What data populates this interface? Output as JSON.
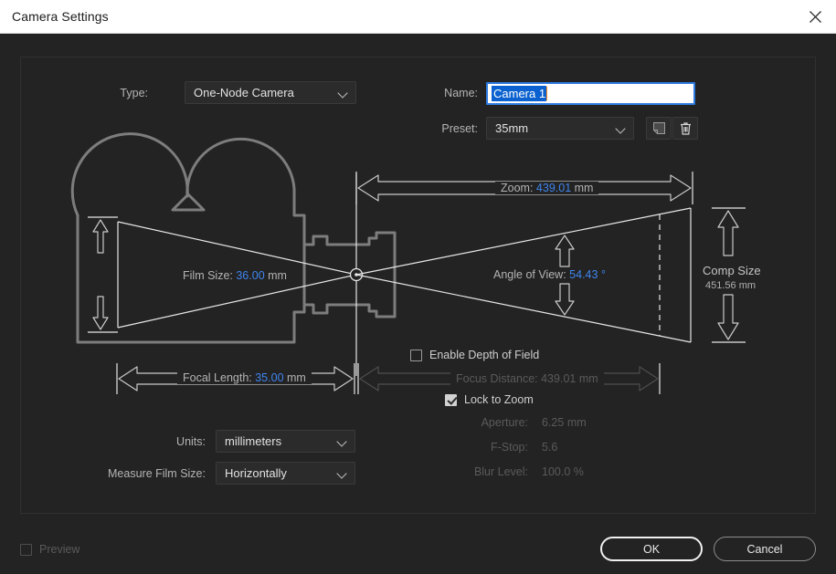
{
  "window": {
    "title": "Camera Settings",
    "close_icon": "close-icon"
  },
  "form": {
    "type_label": "Type:",
    "type_value": "One-Node Camera",
    "name_label": "Name:",
    "name_value": "Camera 1",
    "preset_label": "Preset:",
    "preset_value": "35mm",
    "save_preset_icon": "save-preset-icon",
    "delete_preset_icon": "trash-icon",
    "units_label": "Units:",
    "units_value": "millimeters",
    "measure_label": "Measure Film Size:",
    "measure_value": "Horizontally"
  },
  "diagram": {
    "zoom_label": "Zoom:",
    "zoom_value": "439.01",
    "zoom_unit": "mm",
    "film_size_label": "Film Size:",
    "film_size_value": "36.00",
    "film_size_unit": "mm",
    "angle_label": "Angle of View:",
    "angle_value": "54.43",
    "angle_unit": "°",
    "comp_size_label": "Comp Size",
    "comp_size_value": "451.56 mm",
    "focal_label": "Focal Length:",
    "focal_value": "35.00",
    "focal_unit": "mm",
    "focus_label": "Focus Distance:",
    "focus_value": "439.01",
    "focus_unit": "mm"
  },
  "dof": {
    "enable_label": "Enable Depth of Field",
    "enable_checked": false,
    "lock_label": "Lock to Zoom",
    "lock_checked": true,
    "aperture_label": "Aperture:",
    "aperture_value": "6.25",
    "aperture_unit": "mm",
    "fstop_label": "F-Stop:",
    "fstop_value": "5.6",
    "blur_label": "Blur Level:",
    "blur_value": "100.0",
    "blur_unit": "%"
  },
  "footer": {
    "preview_label": "Preview",
    "preview_checked": false,
    "ok_label": "OK",
    "cancel_label": "Cancel"
  },
  "colors": {
    "accent_value": "#3f85ee",
    "panel_bg": "#232323",
    "titlebar_bg": "#ffffff",
    "selection_blue": "#0b61cf"
  }
}
